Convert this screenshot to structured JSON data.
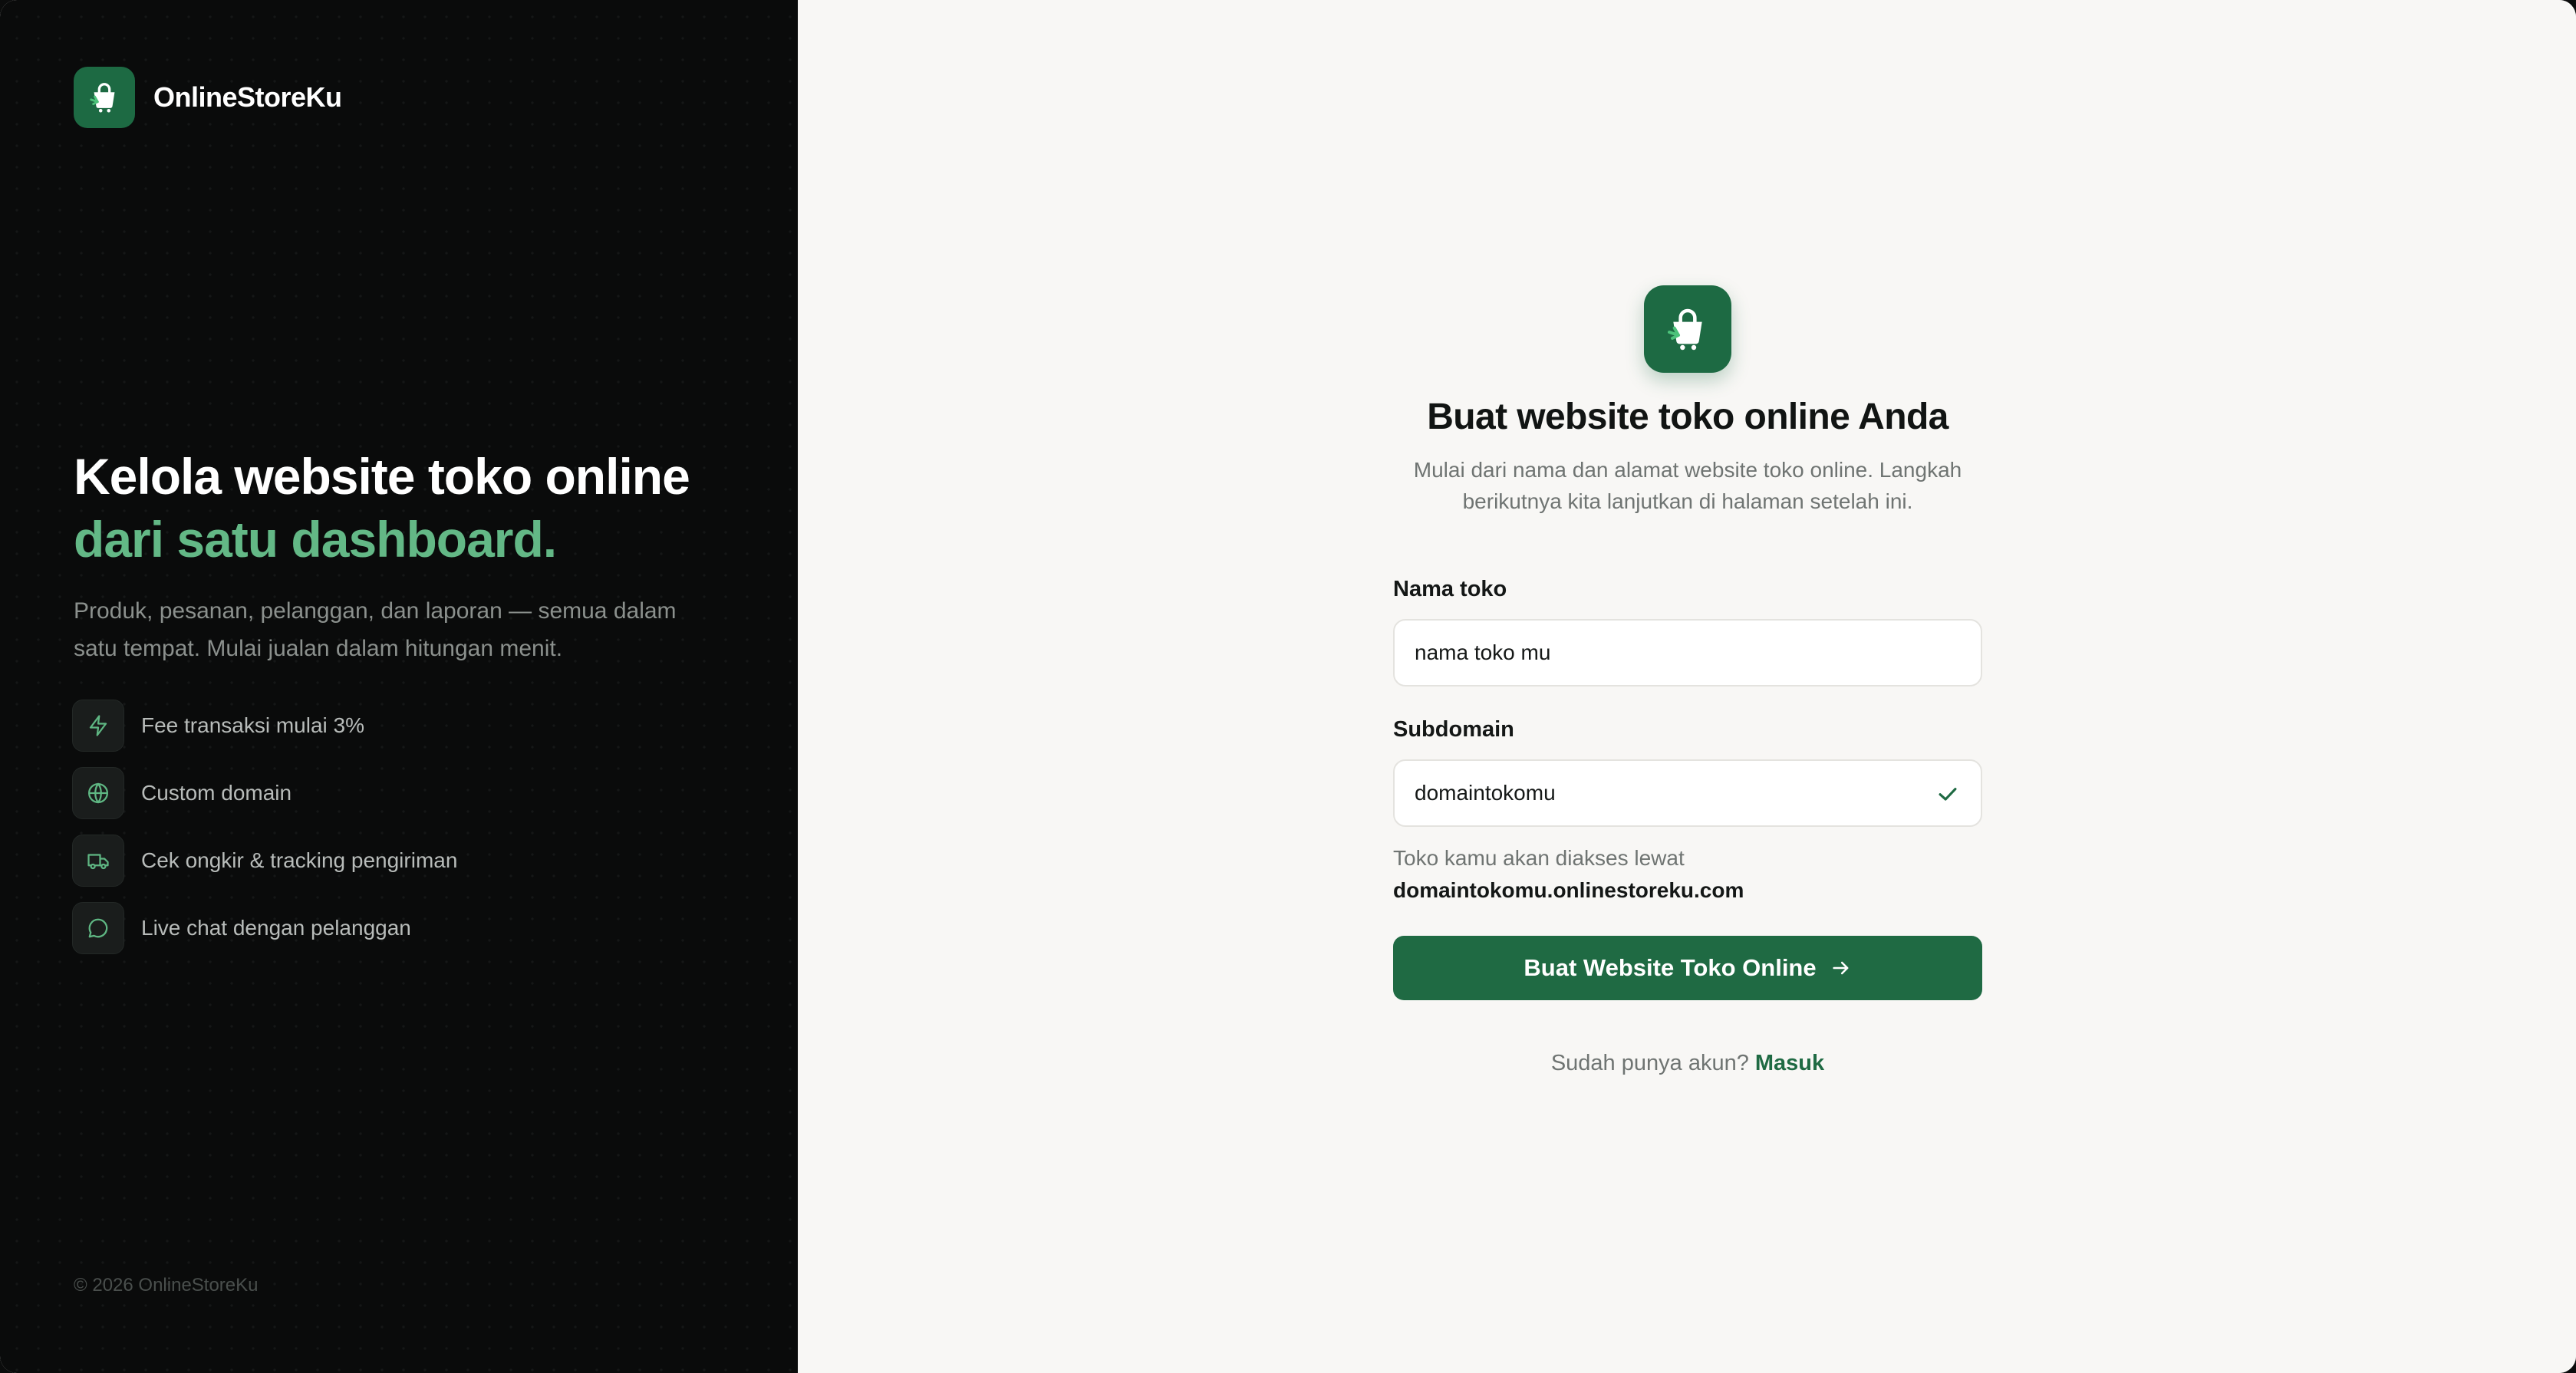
{
  "brand": {
    "name": "OnlineStoreKu",
    "logo_icon": "shopping-bag-icon",
    "color": "#1d6a43"
  },
  "hero": {
    "title_line1": "Kelola website toko online",
    "title_line2": "dari satu dashboard.",
    "description": "Produk, pesanan, pelanggan, dan laporan — semua dalam satu tempat. Mulai jualan dalam hitungan menit."
  },
  "features": [
    {
      "icon": "lightning-icon",
      "label": "Fee transaksi mulai 3%"
    },
    {
      "icon": "globe-icon",
      "label": "Custom domain"
    },
    {
      "icon": "truck-icon",
      "label": "Cek ongkir & tracking pengiriman"
    },
    {
      "icon": "chat-bubble-icon",
      "label": "Live chat dengan pelanggan"
    }
  ],
  "footer": {
    "copyright": "© 2026 OnlineStoreKu"
  },
  "form": {
    "title": "Buat website toko online Anda",
    "subtitle": "Mulai dari nama dan alamat website toko online. Langkah berikutnya kita lanjutkan di halaman setelah ini.",
    "store_name": {
      "label": "Nama toko",
      "value": "nama toko mu"
    },
    "subdomain": {
      "label": "Subdomain",
      "value": "domaintokomu",
      "status_icon": "check-icon"
    },
    "hint_text": "Toko kamu akan diakses lewat",
    "hint_domain": "domaintokomu.onlinestoreku.com",
    "submit_label": "Buat Website Toko Online",
    "signin_prompt": "Sudah punya akun?",
    "signin_link": "Masuk"
  },
  "colors": {
    "accent": "#1f6a43",
    "accent_light": "#63b886",
    "dark_bg": "#0a0b0b",
    "light_bg": "#f8f7f5"
  }
}
